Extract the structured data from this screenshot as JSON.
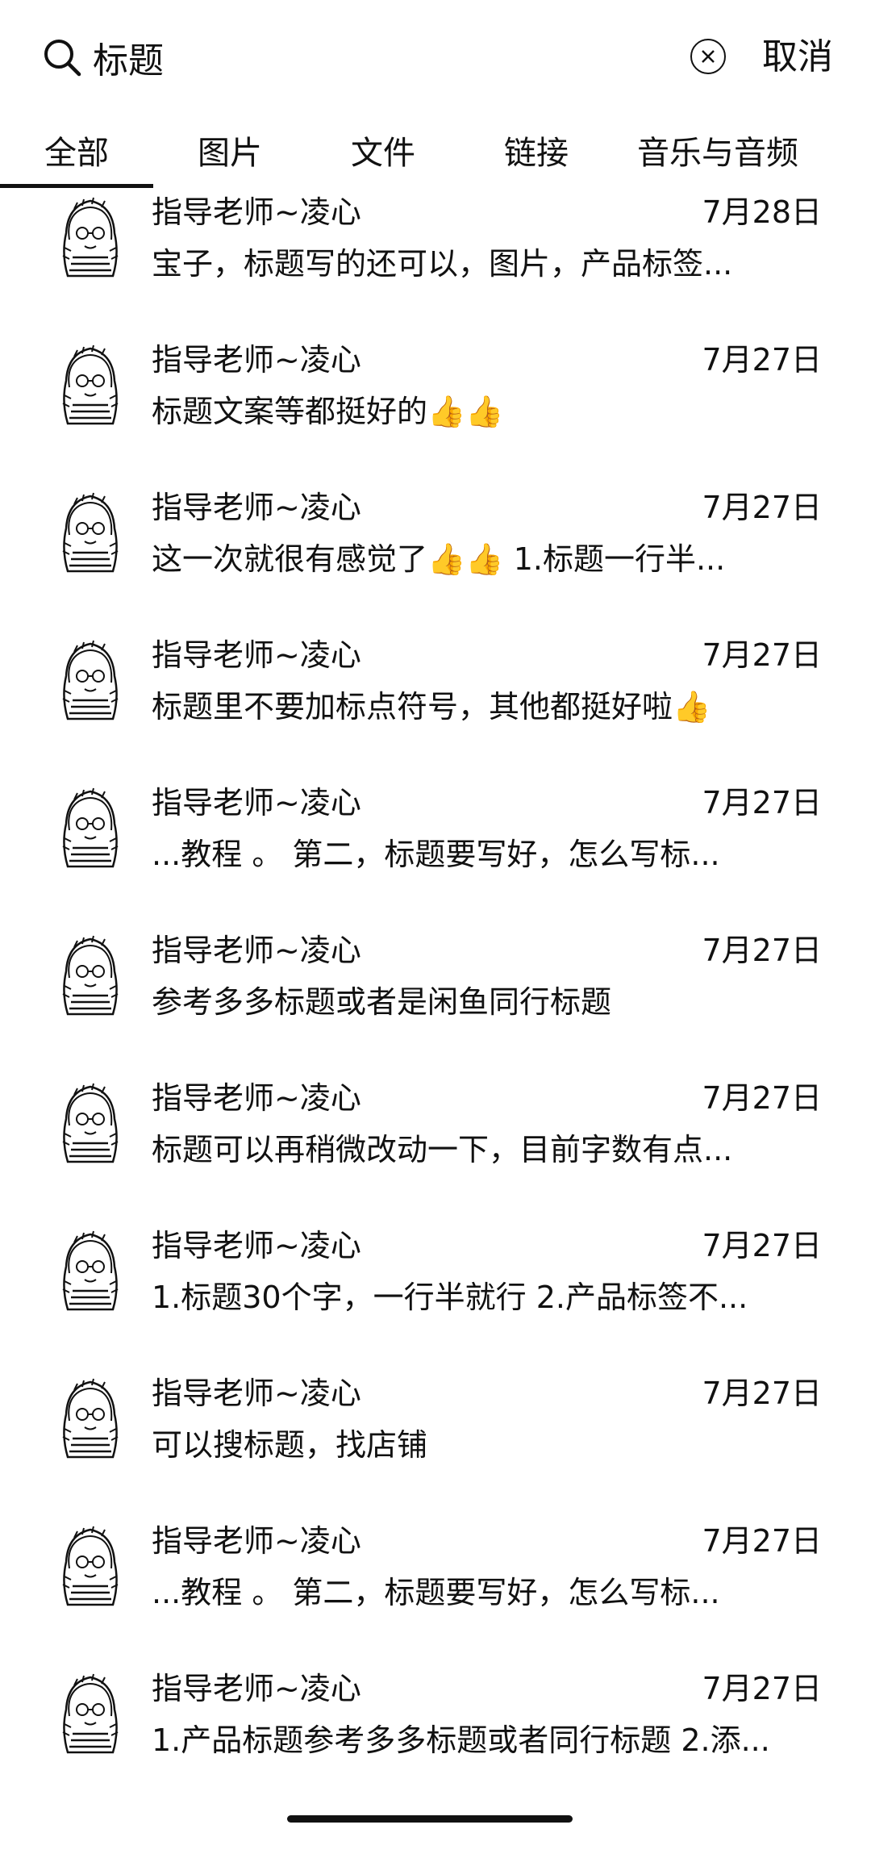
{
  "search": {
    "query": "标题",
    "cancel_label": "取消"
  },
  "tabs": [
    {
      "label": "全部",
      "active": true
    },
    {
      "label": "图片",
      "active": false
    },
    {
      "label": "文件",
      "active": false
    },
    {
      "label": "链接",
      "active": false
    },
    {
      "label": "音乐与音频",
      "active": false
    }
  ],
  "results": [
    {
      "name": "指导老师~凌心",
      "date": "7月28日",
      "snippet": "宝子，标题写的还可以，图片，产品标签..."
    },
    {
      "name": "指导老师~凌心",
      "date": "7月27日",
      "snippet": "标题文案等都挺好的👍👍"
    },
    {
      "name": "指导老师~凌心",
      "date": "7月27日",
      "snippet": "这一次就很有感觉了👍👍 1.标题一行半..."
    },
    {
      "name": "指导老师~凌心",
      "date": "7月27日",
      "snippet": "标题里不要加标点符号，其他都挺好啦👍"
    },
    {
      "name": "指导老师~凌心",
      "date": "7月27日",
      "snippet": "...教程  。 第二，标题要写好，怎么写标..."
    },
    {
      "name": "指导老师~凌心",
      "date": "7月27日",
      "snippet": "参考多多标题或者是闲鱼同行标题"
    },
    {
      "name": "指导老师~凌心",
      "date": "7月27日",
      "snippet": "标题可以再稍微改动一下，目前字数有点..."
    },
    {
      "name": "指导老师~凌心",
      "date": "7月27日",
      "snippet": "1.标题30个字，一行半就行 2.产品标签不..."
    },
    {
      "name": "指导老师~凌心",
      "date": "7月27日",
      "snippet": "可以搜标题，找店铺"
    },
    {
      "name": "指导老师~凌心",
      "date": "7月27日",
      "snippet": "...教程  。 第二，标题要写好，怎么写标..."
    },
    {
      "name": "指导老师~凌心",
      "date": "7月27日",
      "snippet": "1.产品标题参考多多标题或者同行标题 2.添..."
    }
  ]
}
